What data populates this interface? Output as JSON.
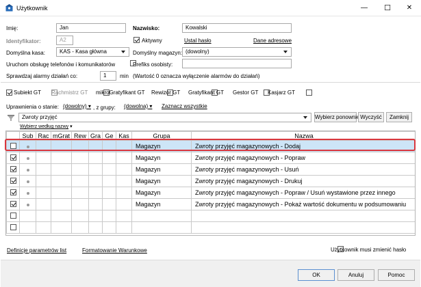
{
  "window": {
    "title": "Użytkownik",
    "minimize_glyph": "—",
    "maximize_glyph": "☐",
    "close_glyph": "✕"
  },
  "form": {
    "imie_label": "Imię:",
    "imie_value": "Jan",
    "nazwisko_label": "Nazwisko:",
    "nazwisko_value": "Kowalski",
    "identyfikator_label": "Identyfikator:",
    "identyfikator_value": "A2",
    "aktywny_label": "Aktywny",
    "ustal_haslo_link": "Ustal hasło",
    "dane_adresowe_link": "Dane adresowe",
    "domyslna_kasa_label": "Domyślna kasa:",
    "domyslna_kasa_value": "KAS - Kasa główna",
    "domyslny_magazyn_label": "Domyślny magazyn:",
    "domyslny_magazyn_value": "(dowolny)",
    "uruchom_label": "Uruchom obsługę telefonów i komunikatorów",
    "prefiks_label": "Prefiks osobisty:",
    "alarmy_label": "Sprawdzaj alarmy działań co:",
    "alarmy_value": "1",
    "alarmy_unit": "min",
    "alarmy_note": "(Wartość 0 oznacza wyłączenie alarmów do działań)"
  },
  "modules": [
    {
      "label": "Subiekt GT",
      "checked": true,
      "gray": false
    },
    {
      "label": "Rachmistrz GT",
      "checked": false,
      "gray": true
    },
    {
      "label": "mikroGratyfikant GT",
      "checked": false,
      "gray": false
    },
    {
      "label": "Rewizor GT",
      "checked": false,
      "gray": false
    },
    {
      "label": "Gratyfikant GT",
      "checked": false,
      "gray": false
    },
    {
      "label": "Gestor GT",
      "checked": false,
      "gray": false
    },
    {
      "label": "Kasjarz GT",
      "checked": false,
      "gray": false
    }
  ],
  "filters": {
    "uprawnienia_label": "Uprawnienia o stanie:",
    "stan_value": "(dowolny)",
    "grupy_label": ", z grupy:",
    "grupa_value": "(dowolna)",
    "zaznacz_link": "Zaznacz wszystkie",
    "search_value": "Zwroty przyjęć",
    "wybierz_ponownie": "Wybierz ponownie",
    "wyczysc": "Wyczyść",
    "zamknij": "Zamknij",
    "sort_label": "Wybierz według nazwy"
  },
  "table": {
    "headers": [
      "Sub",
      "Rac",
      "mGrat",
      "Rew",
      "Gra",
      "Ge",
      "Kas",
      "Grupa",
      "Nazwa"
    ],
    "rows": [
      {
        "checked": false,
        "dot": true,
        "grupa": "Magazyn",
        "nazwa": "Zwroty przyjęć magazynowych - Dodaj",
        "selected": true
      },
      {
        "checked": true,
        "dot": true,
        "grupa": "Magazyn",
        "nazwa": "Zwroty przyjęć magazynowych - Popraw",
        "selected": false
      },
      {
        "checked": true,
        "dot": true,
        "grupa": "Magazyn",
        "nazwa": "Zwroty przyjęć magazynowych - Usuń",
        "selected": false
      },
      {
        "checked": true,
        "dot": true,
        "grupa": "Magazyn",
        "nazwa": "Zwroty przyjęć magazynowych - Drukuj",
        "selected": false
      },
      {
        "checked": true,
        "dot": true,
        "grupa": "Magazyn",
        "nazwa": "Zwroty przyjęć magazynowych - Popraw / Usuń wystawione przez innego",
        "selected": false
      },
      {
        "checked": true,
        "dot": true,
        "grupa": "Magazyn",
        "nazwa": "Zwroty przyjęć magazynowych - Pokaż wartość dokumentu w podsumowaniu",
        "selected": false
      },
      {
        "checked": false,
        "dot": false,
        "grupa": "",
        "nazwa": "",
        "selected": false
      },
      {
        "checked": false,
        "dot": false,
        "grupa": "",
        "nazwa": "",
        "selected": false
      }
    ]
  },
  "bottom": {
    "definicje_link": "Definicje parametrów list",
    "formatowanie_link": "Formatowanie Warunkowe",
    "musi_zmienic_label": "Użytkownik musi zmienić hasło"
  },
  "footer": {
    "ok": "OK",
    "anuluj": "Anuluj",
    "pomoc": "Pomoc"
  },
  "colors": {
    "selection_border": "#d9363e",
    "selection_bg": "#cde5f7",
    "title_icon": "#2a6ebb"
  }
}
